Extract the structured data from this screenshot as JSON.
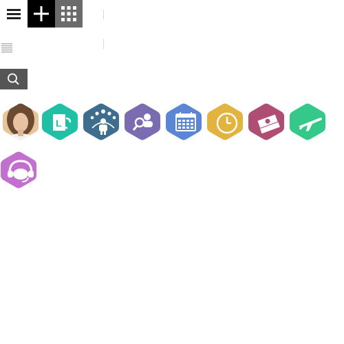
{
  "toolbar": {
    "menu_icon": "hamburger-menu-icon",
    "add_icon": "plus-icon",
    "apps_icon": "app-grid-icon",
    "list_icon": "list-lines-icon",
    "search_icon": "search-icon",
    "colors": {
      "add_bg": "#000000",
      "apps_bg": "#6b6b6b",
      "search_bg": "#555555"
    }
  },
  "apps": [
    {
      "id": "profile",
      "icon": "user-avatar-photo",
      "color": "#e8c89a"
    },
    {
      "id": "leave-request",
      "icon": "leave-exchange-icon",
      "color": "#1fc0a6"
    },
    {
      "id": "team",
      "icon": "team-people-icon",
      "color": "#3f6d8e"
    },
    {
      "id": "recruitment",
      "icon": "person-search-icon",
      "color": "#7b6bb0"
    },
    {
      "id": "calendar",
      "icon": "calendar-icon",
      "color": "#5b86d6"
    },
    {
      "id": "timesheet",
      "icon": "clock-icon",
      "color": "#e2b43f"
    },
    {
      "id": "expenses",
      "icon": "money-cash-icon",
      "color": "#b04d73"
    },
    {
      "id": "travel",
      "icon": "airplane-icon",
      "color": "#34c98a"
    },
    {
      "id": "helpdesk",
      "icon": "headset-support-icon",
      "color": "#c36fcf"
    }
  ]
}
